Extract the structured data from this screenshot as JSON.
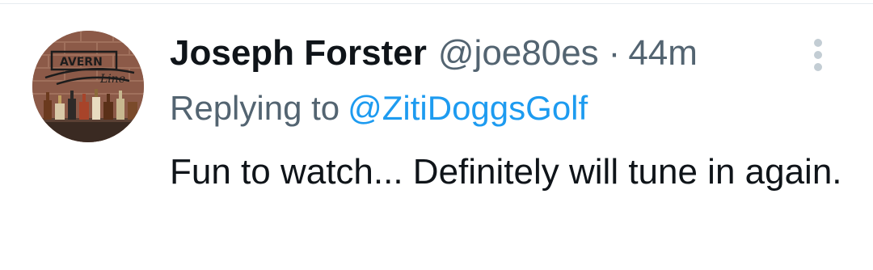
{
  "tweet": {
    "author_name": "Joseph Forster",
    "author_handle": "@joe80es",
    "separator": "·",
    "timestamp": "44m",
    "reply_prefix": "Replying to",
    "reply_to_handle": "@ZitiDoggsGolf",
    "text": "Fun to watch... Definitely will tune in again.",
    "avatar_sign_text": "AVERN",
    "avatar_script_text": "Line"
  },
  "icons": {
    "more": "more-vertical-icon"
  },
  "colors": {
    "name": "#0f1419",
    "secondary": "#536471",
    "link": "#1d9bf0",
    "dots": "#c3cdd4"
  }
}
